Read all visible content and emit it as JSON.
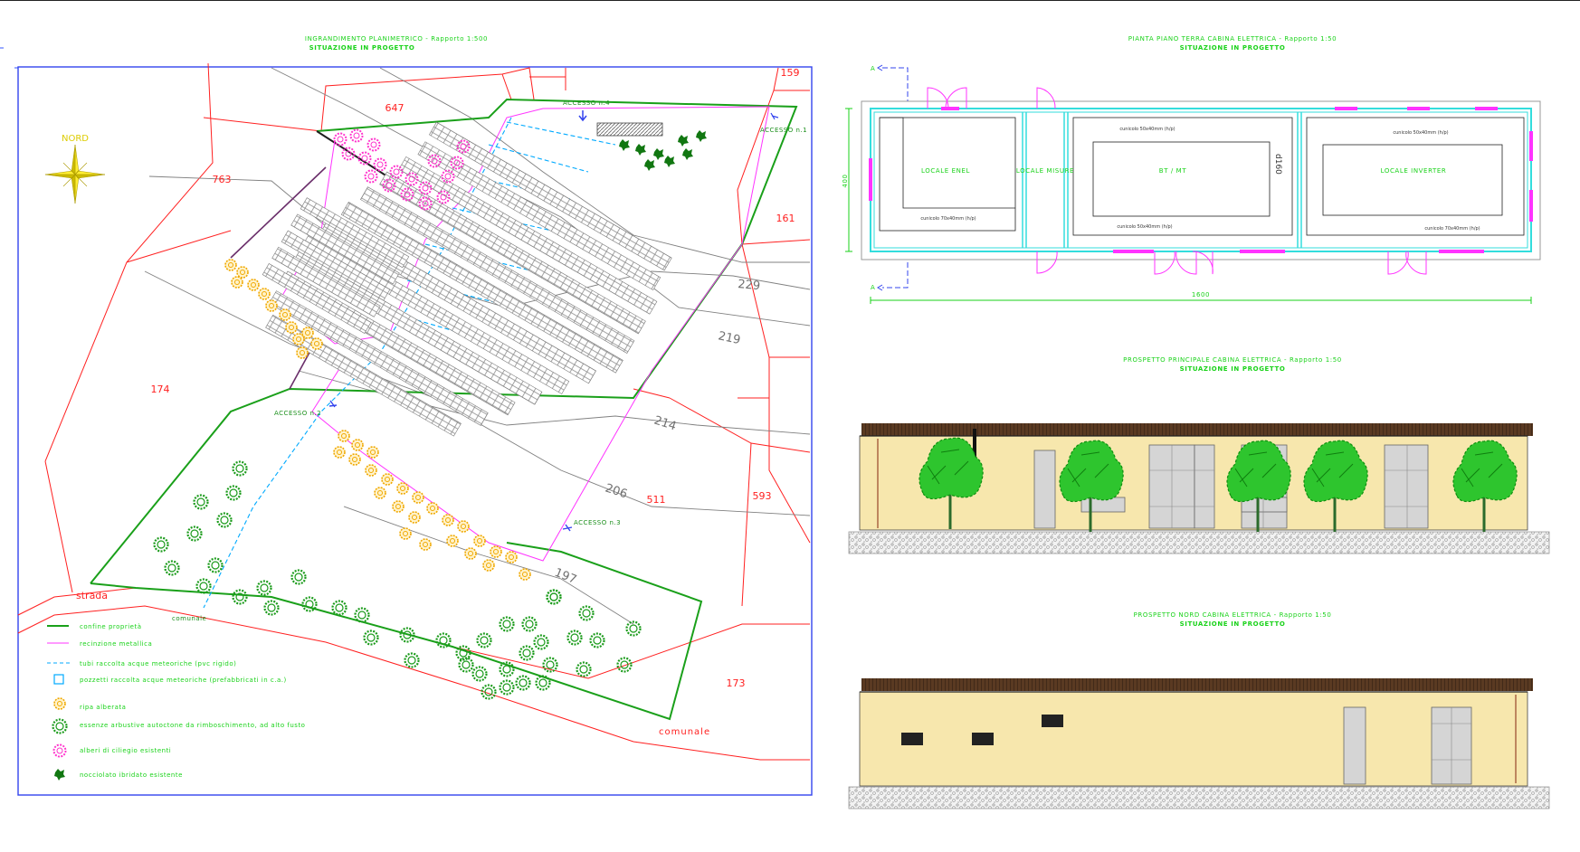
{
  "site_plan": {
    "title": "INGRANDIMENTO PLANIMETRICO - Rapporto 1:500",
    "subtitle": "SITUAZIONE IN PROGETTO",
    "north_label": "NORD",
    "parcels": [
      "159",
      "647",
      "763",
      "161",
      "174",
      "511",
      "593",
      "173"
    ],
    "contours": [
      "229",
      "219",
      "214",
      "206",
      "197"
    ],
    "roads": [
      "strada",
      "comunale"
    ],
    "accesses": [
      "ACCESSO n.4",
      "ACCESSO n.1",
      "ACCESSO n.2",
      "ACCESSO n.3"
    ],
    "legend": [
      {
        "label": "confine proprietà",
        "symbol": "line",
        "color": "#1aa01a"
      },
      {
        "label": "recinzione metallica",
        "symbol": "line",
        "color": "#ff33ff"
      },
      {
        "label": "tubi raccolta acque meteoriche (pvc rigido)",
        "symbol": "dash",
        "color": "#00aaff"
      },
      {
        "label": "pozzetti raccolta acque meteoriche (prefabbricati in c.a.)",
        "symbol": "square",
        "color": "#00aaff"
      },
      {
        "label": "ripa alberata",
        "symbol": "ring",
        "color": "#ffaa00"
      },
      {
        "label": "essenze arbustive autoctone da rimboschimento, ad alto fusto",
        "symbol": "ring",
        "color": "#119911"
      },
      {
        "label": "alberi di ciliegio esistenti",
        "symbol": "flower",
        "color": "#ff33cc"
      },
      {
        "label": "nocciolato ibridato esistente",
        "symbol": "blot",
        "color": "#117711"
      }
    ]
  },
  "floor_plan": {
    "title": "PIANTA PIANO TERRA CABINA ELETTRICA - Rapporto 1:50",
    "subtitle": "SITUAZIONE IN PROGETTO",
    "section_marks": [
      "A",
      "A"
    ],
    "rooms": [
      "LOCALE ENEL",
      "LOCALE MISURE",
      "BT / MT",
      "LOCALE INVERTER"
    ],
    "width_label": "1600",
    "height_label": "400",
    "annotations": [
      "cunicolo 50x40mm (h/p)",
      "cunicolo 70x40mm (h/p)",
      "d160",
      "cunicolo 50x40mm (h/p)",
      "cunicolo 50x40mm (h/p)",
      "cunicolo 70x40mm (h/p)",
      "cunicolo 50x40mm (h/p)",
      "cunicolo 50x40mm (h/p)",
      "cunicolo 50x40mm (h/p)"
    ]
  },
  "front_elevation": {
    "title": "PROSPETTO PRINCIPALE CABINA ELETTRICA - Rapporto 1:50",
    "subtitle": "SITUAZIONE IN PROGETTO"
  },
  "north_elevation": {
    "title": "PROSPETTO NORD CABINA ELETTRICA - Rapporto 1:50",
    "subtitle": "SITUAZIONE IN PROGETTO"
  },
  "colors": {
    "title_green": "#19d219",
    "parcel_red": "#ff2020",
    "boundary_green": "#1aa01a",
    "fence_magenta": "#ff33ff",
    "drain_cyan": "#00aaff",
    "wall_cyan": "#33dddd",
    "building_cream": "#f7e7ad",
    "roof_brown": "#5a3a22"
  }
}
